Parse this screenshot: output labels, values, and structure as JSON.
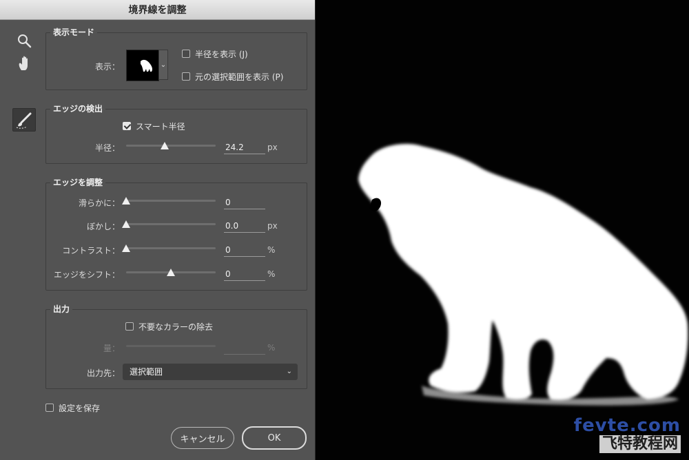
{
  "dialog": {
    "title": "境界線を調整",
    "tools": {
      "zoom_icon": "magnifier-icon",
      "hand_icon": "hand-icon",
      "brush_icon": "refine-radius-brush-icon"
    },
    "view_mode": {
      "title": "表示モード",
      "view_label": "表示：",
      "show_radius_label": "半径を表示 (J)",
      "show_radius_checked": false,
      "show_original_label": "元の選択範囲を表示 (P)",
      "show_original_checked": false
    },
    "edge_detection": {
      "title": "エッジの検出",
      "smart_radius_label": "スマート半径",
      "smart_radius_checked": true,
      "radius_label": "半径：",
      "radius_value": "24.2",
      "radius_unit": "px",
      "radius_level": 0.48
    },
    "adjust_edge": {
      "title": "エッジを調整",
      "smooth_label": "滑らかに：",
      "smooth_value": "0",
      "smooth_level": 0,
      "feather_label": "ぼかし：",
      "feather_value": "0.0",
      "feather_unit": "px",
      "feather_level": 0,
      "contrast_label": "コントラスト：",
      "contrast_value": "0",
      "contrast_unit": "%",
      "contrast_level": 0,
      "shift_label": "エッジをシフト：",
      "shift_value": "0",
      "shift_unit": "%",
      "shift_level": 0.5
    },
    "output": {
      "title": "出力",
      "decontaminate_label": "不要なカラーの除去",
      "decontaminate_checked": false,
      "amount_label": "量：",
      "amount_value": "",
      "amount_unit": "%",
      "output_to_label": "出力先：",
      "output_to_value": "選択範囲"
    },
    "remember_label": "設定を保存",
    "remember_checked": false,
    "cancel_label": "キャンセル",
    "ok_label": "OK"
  },
  "watermark": {
    "line1": "fevte.com",
    "line2": "飞特教程网"
  },
  "colors": {
    "dialog_bg": "#535353",
    "canvas_bg": "#020202",
    "watermark_blue": "#2d4ea5"
  }
}
